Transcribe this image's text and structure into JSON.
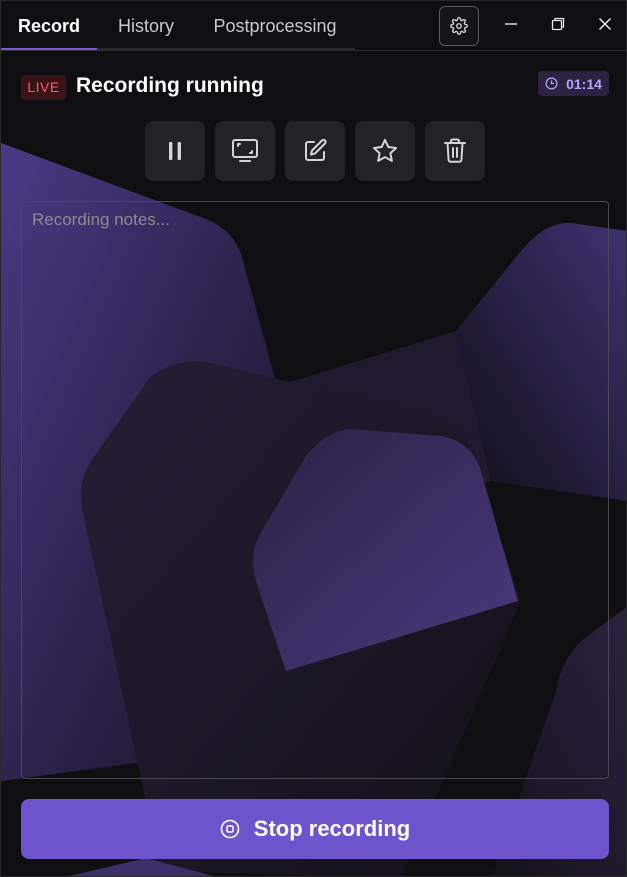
{
  "tabs": [
    {
      "label": "Record",
      "active": true
    },
    {
      "label": "History",
      "active": false
    },
    {
      "label": "Postprocessing",
      "active": false
    }
  ],
  "window_controls": {
    "settings_icon": "gear-icon",
    "minimize_icon": "minimize-icon",
    "restore_icon": "restore-icon",
    "close_icon": "close-icon"
  },
  "status": {
    "live_label": "LIVE",
    "title": "Recording running",
    "timer_icon": "clock-icon",
    "timer": "01:14"
  },
  "actions": [
    {
      "name": "pause",
      "icon": "pause-icon"
    },
    {
      "name": "screen",
      "icon": "screen-icon"
    },
    {
      "name": "edit",
      "icon": "edit-icon"
    },
    {
      "name": "favorite",
      "icon": "star-icon"
    },
    {
      "name": "delete",
      "icon": "trash-icon"
    }
  ],
  "notes": {
    "placeholder": "Recording notes...",
    "value": ""
  },
  "stop_button": {
    "label": "Stop recording",
    "icon": "stop-circle-icon"
  },
  "colors": {
    "accent": "#6d54cc",
    "live_text": "#ff5a6a",
    "timer_text": "#b7a2ff"
  }
}
